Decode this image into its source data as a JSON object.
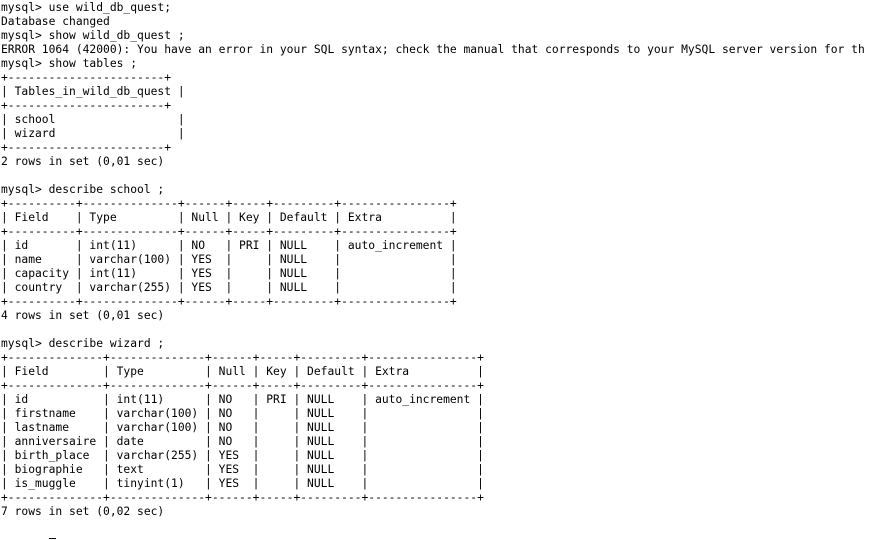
{
  "terminal": {
    "lines": [
      "mysql> use wild_db_quest;",
      "Database changed",
      "mysql> show wild_db_quest ;",
      "ERROR 1064 (42000): You have an error in your SQL syntax; check the manual that corresponds to your MySQL server version for th",
      "mysql> show tables ;",
      "+-----------------------+",
      "| Tables_in_wild_db_quest |",
      "+-----------------------+",
      "| school                  |",
      "| wizard                  |",
      "+-----------------------+",
      "2 rows in set (0,01 sec)",
      "",
      "mysql> describe school ;",
      "+----------+--------------+------+-----+---------+----------------+",
      "| Field    | Type         | Null | Key | Default | Extra          |",
      "+----------+--------------+------+-----+---------+----------------+",
      "| id       | int(11)      | NO   | PRI | NULL    | auto_increment |",
      "| name     | varchar(100) | YES  |     | NULL    |                |",
      "| capacity | int(11)      | YES  |     | NULL    |                |",
      "| country  | varchar(255) | YES  |     | NULL    |                |",
      "+----------+--------------+------+-----+---------+----------------+",
      "4 rows in set (0,01 sec)",
      "",
      "mysql> describe wizard ;",
      "+--------------+--------------+------+-----+---------+----------------+",
      "| Field        | Type         | Null | Key | Default | Extra          |",
      "+--------------+--------------+------+-----+---------+----------------+",
      "| id           | int(11)      | NO   | PRI | NULL    | auto_increment |",
      "| firstname    | varchar(100) | NO   |     | NULL    |                |",
      "| lastname     | varchar(100) | NO   |     | NULL    |                |",
      "| anniversaire | date         | NO   |     | NULL    |                |",
      "| birth_place  | varchar(255) | YES  |     | NULL    |                |",
      "| biographie   | text         | YES  |     | NULL    |                |",
      "| is_muggle    | tinyint(1)   | YES  |     | NULL    |                |",
      "+--------------+--------------+------+-----+---------+----------------+",
      "7 rows in set (0,02 sec)"
    ]
  }
}
